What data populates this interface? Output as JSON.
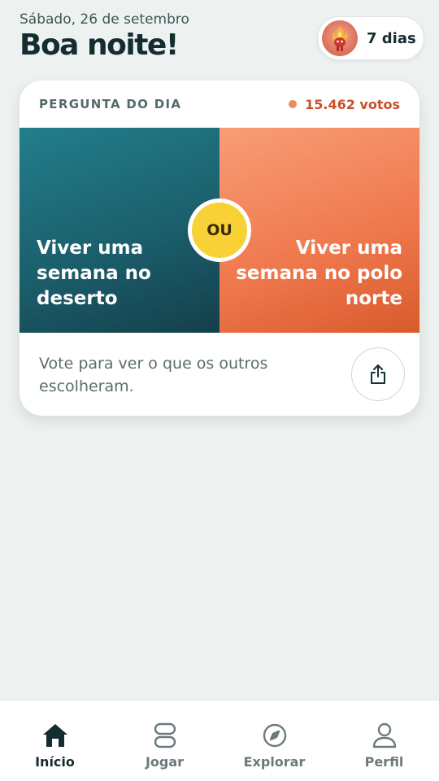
{
  "header": {
    "date": "Sábado, 26 de setembro",
    "greeting": "Boa noite!",
    "streak": {
      "label": "7 dias",
      "icon": "flame-mascot-icon"
    }
  },
  "question": {
    "title": "PERGUNTA DO DIA",
    "votes": "15.462 votos",
    "option_a": "Viver uma semana no deserto",
    "option_b": "Viver uma semana no polo norte",
    "separator": "OU",
    "prompt": "Vote para ver o que os outros escolheram.",
    "share_icon": "share-icon"
  },
  "tabs": [
    {
      "label": "Início",
      "icon": "home-icon",
      "active": true
    },
    {
      "label": "Jogar",
      "icon": "cards-icon",
      "active": false
    },
    {
      "label": "Explorar",
      "icon": "compass-icon",
      "active": false
    },
    {
      "label": "Perfil",
      "icon": "profile-icon",
      "active": false
    }
  ],
  "colors": {
    "background": "#edf2f0",
    "option_a": "#1b5f6c",
    "option_b": "#f07a4f",
    "separator": "#f8d136",
    "accent": "#c8502b"
  }
}
